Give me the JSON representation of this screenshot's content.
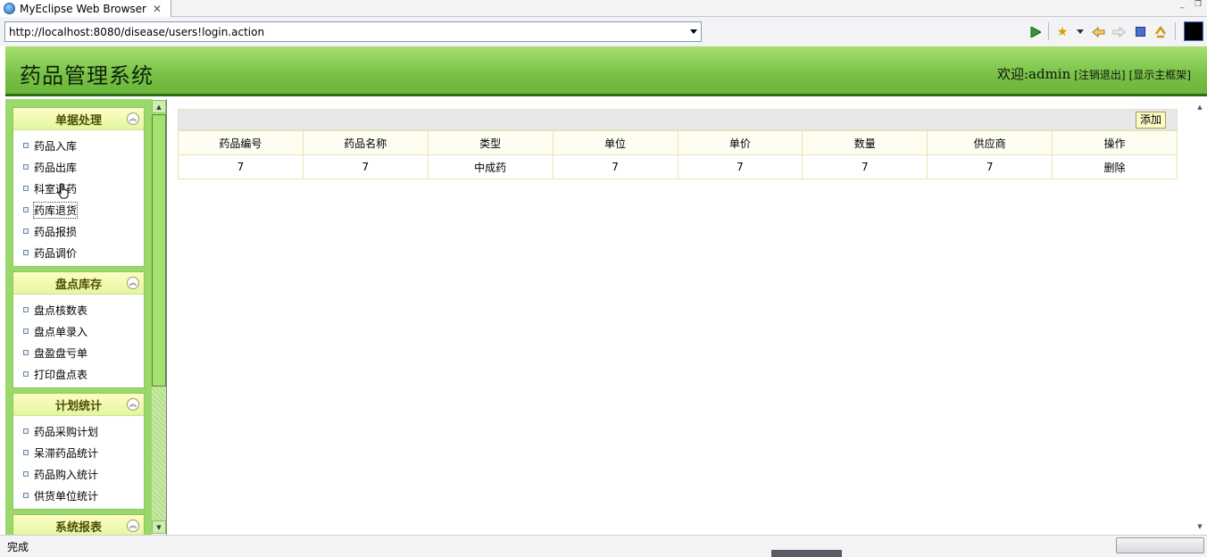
{
  "browser": {
    "tab_title": "MyEclipse Web Browser",
    "tab_close": "✕",
    "window_min": "_",
    "window_restore": "❐",
    "url": "http://localhost:8080/disease/users!login.action",
    "status": "完成",
    "toolbar_icons": [
      "go-arrow-icon",
      "bookmark-star-icon",
      "dropdown-icon",
      "back-arrow-icon",
      "forward-arrow-icon",
      "stop-icon",
      "refresh-icon",
      "console-icon"
    ]
  },
  "header": {
    "title": "药品管理系统",
    "welcome": "欢迎:admin",
    "logout": "[注销退出]",
    "show_main": "[显示主框架]"
  },
  "sidebar": {
    "panels": [
      {
        "title": "单据处理",
        "items": [
          "药品入库",
          "药品出库",
          "科室退药",
          "药库退货",
          "药品报损",
          "药品调价"
        ]
      },
      {
        "title": "盘点库存",
        "items": [
          "盘点核数表",
          "盘点单录入",
          "盘盈盘亏单",
          "打印盘点表"
        ]
      },
      {
        "title": "计划统计",
        "items": [
          "药品采购计划",
          "呆滞药品统计",
          "药品购入统计",
          "供货单位统计"
        ]
      },
      {
        "title": "系统报表",
        "items": []
      }
    ]
  },
  "table": {
    "add_label": "添加",
    "columns": [
      "药品编号",
      "药品名称",
      "类型",
      "单位",
      "单价",
      "数量",
      "供应商",
      "操作"
    ],
    "rows": [
      [
        "7",
        "7",
        "中成药",
        "7",
        "7",
        "7",
        "7",
        "删除"
      ]
    ]
  },
  "colors": {
    "header_green": "#77c146",
    "header_border": "#2f6b16",
    "panel_title": "#4e4e00"
  }
}
